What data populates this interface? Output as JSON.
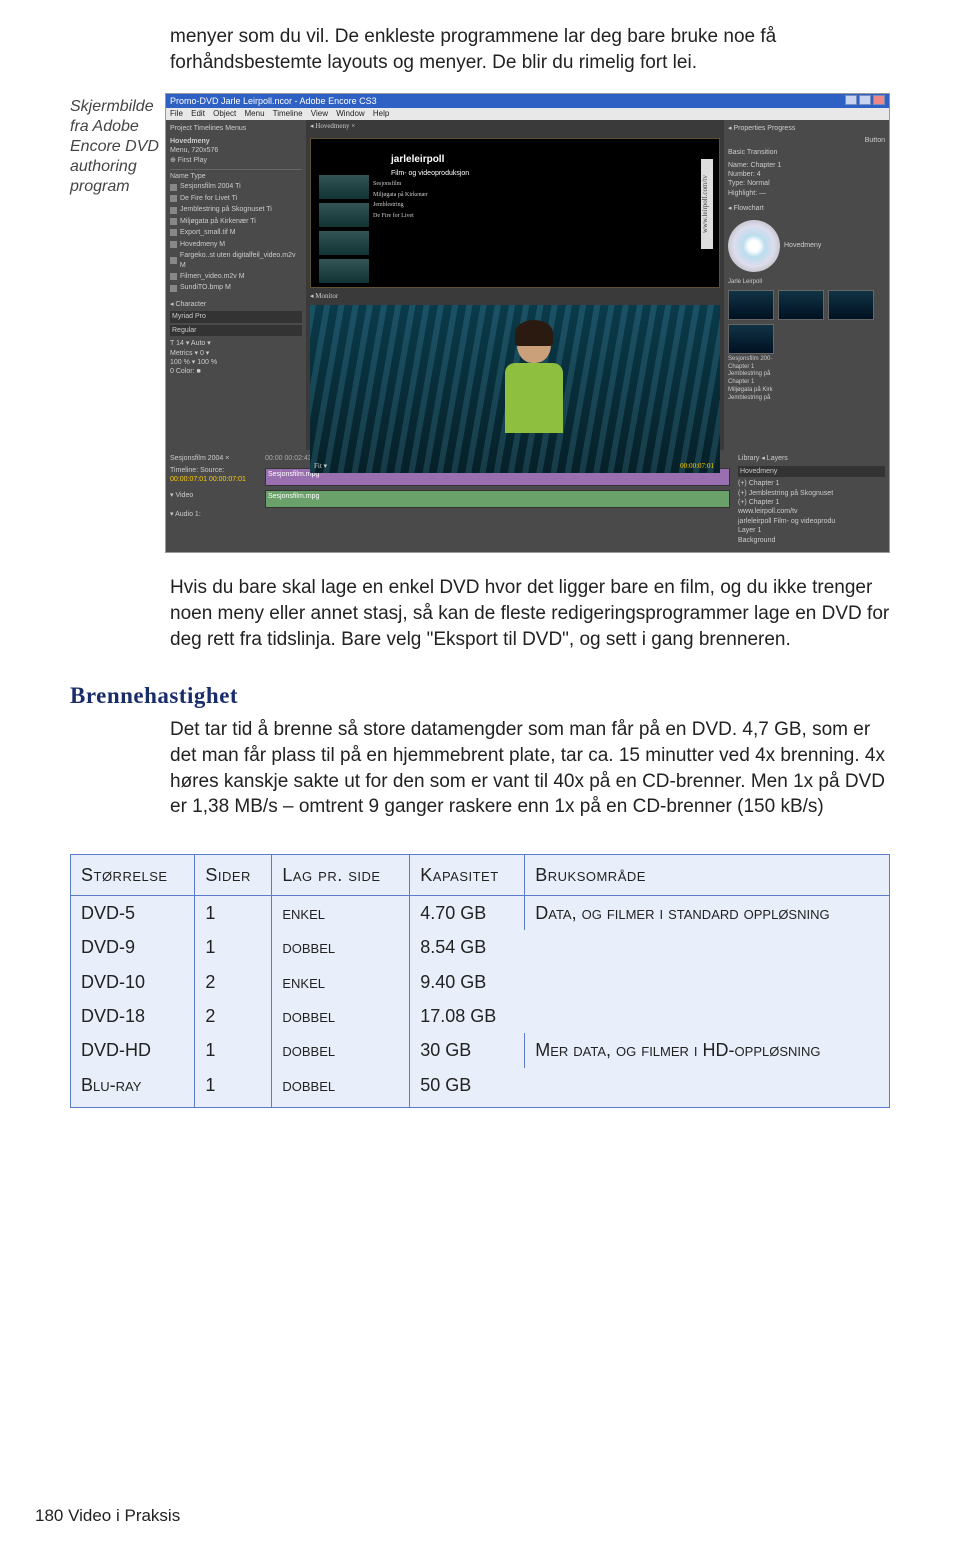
{
  "intro": "menyer som du vil. De enkleste programmene lar deg bare bruke noe få forhåndsbestemte layouts og menyer. De blir du rimelig fort lei.",
  "caption": "Skjermbilde fra Adobe Encore DVD authoring program",
  "screenshot": {
    "title": "Promo-DVD Jarle Leirpoll.ncor - Adobe Encore CS3",
    "menus": [
      "File",
      "Edit",
      "Object",
      "Menu",
      "Timeline",
      "View",
      "Window",
      "Help"
    ],
    "leftTabs": "Project   Timelines   Menus",
    "leftHeader": "Hovedmeny",
    "leftSub": "Menu, 720x576",
    "leftSub2": "⊕ First Play",
    "leftCols": "Name                              Type",
    "leftItems": [
      "Sesjonsfilm 2004            Ti",
      "De Fire for Livet              Ti",
      "Jemblestring på Skognuset  Ti",
      "Miljøgata på Kirkenær      Ti",
      "Export_small.tif              M",
      "Hovedmeny                    M",
      "Fargeko..st uten digitalfeil_video.m2v  M",
      "Filmen_video.m2v           M",
      "SundiTO.bmp                 M"
    ],
    "charPanel": "◂ Character",
    "font": "Myriad Pro",
    "fontStyle": "Regular",
    "sizeRow": "T  14      ▾     Auto   ▾",
    "metricsRow": "Metrics  ▾    0         ▾",
    "pctRow": "100 %   ▾   100 %",
    "colorRow": "0            Color: ■",
    "midTabs": "◂ Hovedmeny ×",
    "brand": "jarleleirpoll",
    "brandSub": "Film- og videoproduksjon",
    "vertical": "www.leirpoll.com/tv",
    "thlabels": [
      "Sesjonsfilm",
      "Miljøgata på Kirkenær",
      "Jemblestring",
      "De Fire for Livet"
    ],
    "monitor": "◂ Monitor",
    "fit": "Fit    ▾",
    "tc1": "00:00:07:01",
    "rightTabs": "◂ Properties   Progress",
    "rBtn": "Button",
    "rBasic": "Basic    Transition",
    "rName": "Name:  Chapter 1",
    "rNum": "Number:  4",
    "rType": "Type:  Normal",
    "rHi": "Highlight:  —",
    "rFlow": "◂ Flowchart",
    "discLabel": "Jarle Leirpoll",
    "flowItems": [
      "Hovedmeny",
      "Sesjonsfilm 200·",
      "Chapter 1",
      "Jemblestring på",
      "Chapter 1",
      "Sesjonsfilm 200·",
      "Miljøgata på Kirk",
      "Jemblestring på"
    ],
    "tlTabs": "Sesjonsfilm 2004 ×",
    "tlLabel": "Timeline:   Source:",
    "tlTc": "00:00:07:01   00:00:07:01",
    "tlRuler": "00:00                                00:02:43:21                              00:05:27:17                              00:08",
    "videoLabel": "▾ Video",
    "audioLabel": "▾ Audio 1:",
    "clip": "Sesjonsfilm.mpg",
    "libTabs": "Library   ◂ Layers",
    "layersHead": "Hovedmeny",
    "layers": [
      "(+) Chapter 1",
      "(+) Jemblestring på Skognuset",
      "(+) Chapter 1",
      "www.leirpoll.com/tv",
      "jarleleirpoll Film- og videoprodu",
      "Layer 1",
      "Background"
    ]
  },
  "para2": "Hvis du bare skal lage en enkel DVD hvor det ligger bare en film, og du ikke trenger noen meny eller annet stasj, så kan de fleste redigeringsprogrammer lage en DVD for deg rett fra tidslinja. Bare velg \"Eksport til DVD\", og sett i gang brenneren.",
  "heading": "Brennehastighet",
  "para3": "Det tar tid å brenne så store datamengder som man får på en DVD. 4,7 GB, som er det man får plass til på en hjemmebrent plate, tar ca. 15 minutter ved 4x brenning. 4x høres kanskje sakte ut for den som er vant til 40x på en CD-brenner. Men 1x på DVD er 1,38 MB/s – omtrent 9 ganger raskere enn 1x på en CD-brenner (150 kB/s)",
  "table": {
    "headers": [
      "Størrelse",
      "Sider",
      "Lag pr. side",
      "Kapasitet",
      "Bruksområde"
    ],
    "rows": [
      [
        "DVD-5",
        "1",
        "enkel",
        "4.70 GB"
      ],
      [
        "DVD-9",
        "1",
        "dobbel",
        "8.54 GB"
      ],
      [
        "DVD-10",
        "2",
        "enkel",
        "9.40 GB"
      ],
      [
        "DVD-18",
        "2",
        "dobbel",
        "17.08 GB"
      ],
      [
        "DVD-HD",
        "1",
        "dobbel",
        "30 GB"
      ],
      [
        "Blu-ray",
        "1",
        "dobbel",
        "50 GB"
      ]
    ],
    "use1": "Data, og filmer i standard oppløsning",
    "use2": "Mer data, og filmer i HD-oppløsning"
  },
  "footer": "180  Video i Praksis"
}
